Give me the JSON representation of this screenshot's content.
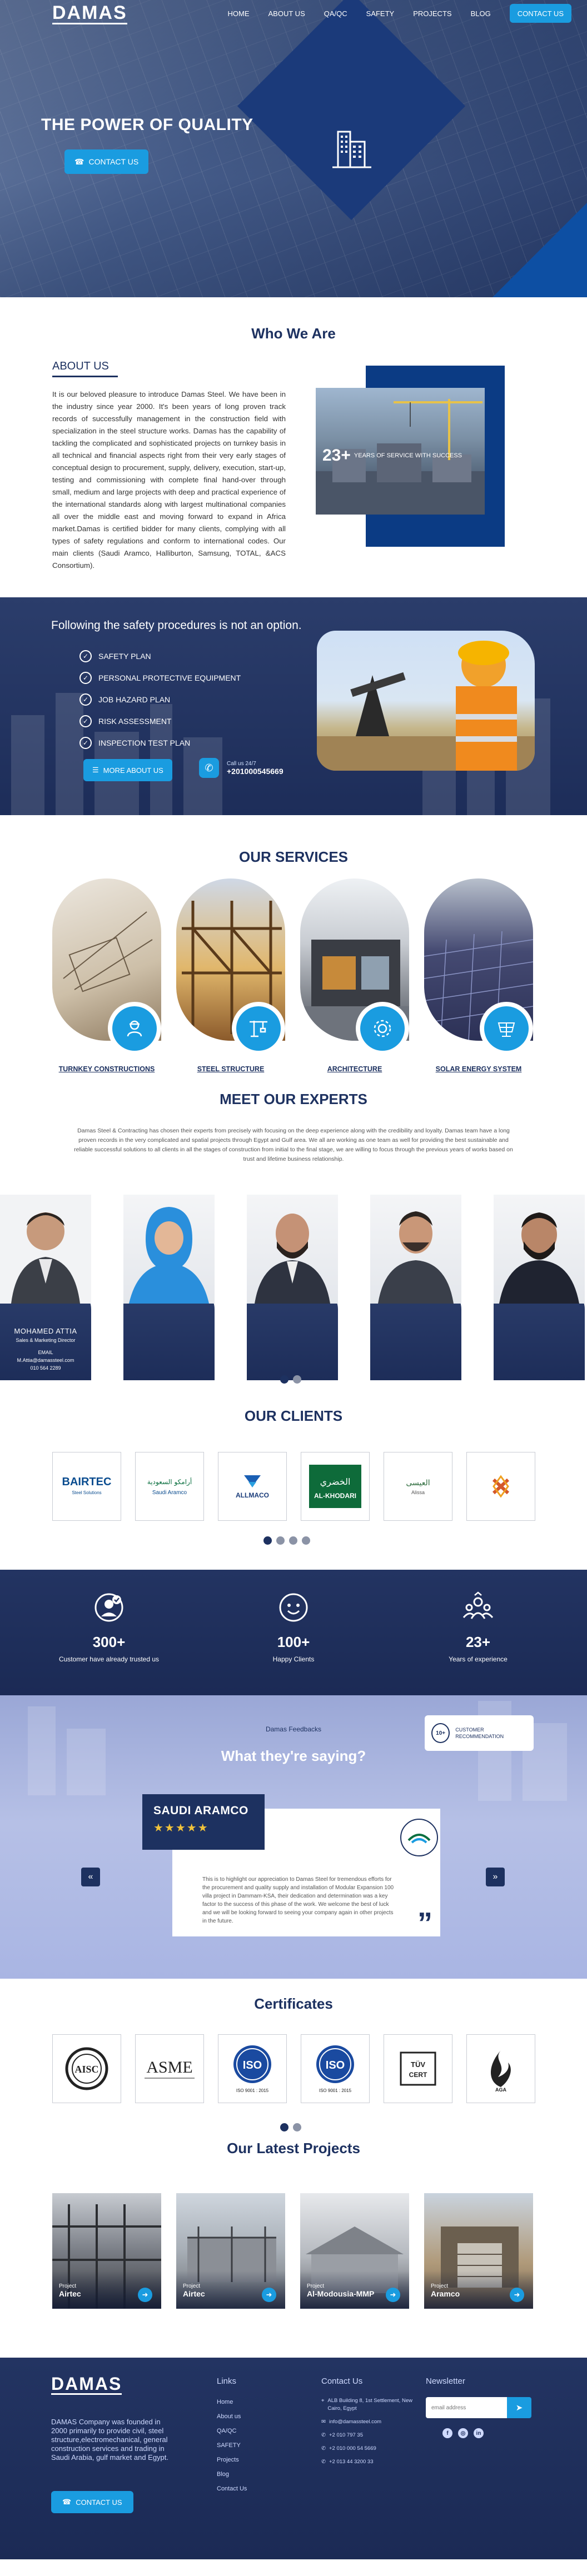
{
  "brand": {
    "logo": "DAMAS"
  },
  "nav": {
    "items": [
      "HOME",
      "ABOUT US",
      "QA/QC",
      "SAFETY",
      "PROJECTS",
      "BLOG"
    ],
    "contact_label": "CONTACT US"
  },
  "hero": {
    "title": "THE POWER OF QUALITY",
    "cta": "CONTACT US"
  },
  "who": {
    "title": "Who We Are",
    "label": "ABOUT US",
    "text": "It is our beloved pleasure to introduce Damas Steel. We have been in the industry since year 2000. It's been years of long proven track records of successfully management in the construction field with specialization in the steel structure works. Damas has the capability of tackling the complicated and sophisticated projects on turnkey basis in all technical and financial aspects right from their very early stages of conceptual design to procurement, supply, delivery, execution, start-up, testing and commissioning with complete final hand-over through small, medium and large projects with deep and practical experience of the international standards along with largest multinational companies all over the middle east and moving forward to expand in Africa market.Damas is certified bidder for many clients, complying with all types of safety regulations and conform to international codes. Our main clients (Saudi Aramco, Halliburton, Samsung, TOTAL, &ACS Consortium).",
    "badge_num": "23+",
    "badge_text": "YEARS OF SERVICE WITH SUCCESS"
  },
  "safety": {
    "title": "Following the safety procedures is not an option.",
    "items": [
      "SAFETY PLAN",
      "PERSONAL PROTECTIVE EQUIPMENT",
      "JOB HAZARD PLAN",
      "RISK ASSESSMENT",
      "INSPECTION TEST PLAN"
    ],
    "more": "MORE ABOUT US",
    "call_label": "Call us 24/7",
    "call_number": "+201000545669"
  },
  "services": {
    "title": "OUR SERVICES",
    "items": [
      {
        "label": "TURNKEY CONSTRUCTIONS",
        "icon": "engineer-icon"
      },
      {
        "label": "STEEL STRUCTURE",
        "icon": "crane-icon"
      },
      {
        "label": "ARCHITECTURE",
        "icon": "gear-icon"
      },
      {
        "label": "SOLAR ENERGY SYSTEM",
        "icon": "solar-panel-icon"
      }
    ]
  },
  "experts": {
    "title": "MEET OUR EXPERTS",
    "intro": "Damas Steel & Contracting has chosen their experts from precisely with focusing on the deep experience along with the credibility and loyalty. Damas team have a long proven records in the very complicated and spatial projects through Egypt and Gulf area. We all are working as one team as well for providing the best sustainable and reliable successful solutions to all clients in all the stages of construction from initial to the final stage, we are willing to focus through the previous years of works based on trust and lifetime business relationship.",
    "featured": {
      "name": "MOHAMED ATTIA",
      "role": "Sales & Marketing Director",
      "email_label": "EMAIL",
      "email": "M.Attia@damassteel.com",
      "phone": "010 564 2289"
    }
  },
  "clients": {
    "title": "OUR CLIENTS",
    "logos": [
      "BAIRTEC Steel Solutions",
      "Saudi Aramco",
      "ALLMACO",
      "AL-KHODARI",
      "Alissa",
      "Kuwait Petroleum"
    ]
  },
  "stats": [
    {
      "num": "300+",
      "label": "Customer have already trusted us",
      "icon": "medal-icon"
    },
    {
      "num": "100+",
      "label": "Happy Clients",
      "icon": "smile-icon"
    },
    {
      "num": "23+",
      "label": "Years of experience",
      "icon": "team-icon"
    }
  ],
  "testimonials": {
    "eyebrow": "Damas Feedbacks",
    "title": "What they're saying?",
    "badge_num": "10+",
    "badge_text": "CUSTOMER RECOMMENDATION",
    "company": "SAUDI ARAMCO",
    "stars": "★★★★★",
    "text": "This is to highlight our appreciation to Damas Steel for tremendous efforts for the procurement and quality supply and installation of Modular Expansion 100 villa project in Dammam-KSA, their dedication and determination was a key factor to the success of this phase of the work. We welcome the best of luck and we will be looking forward to seeing your company again in other projects in the future."
  },
  "certificates": {
    "title": "Certificates",
    "items": [
      "AISC",
      "ASME",
      "ISO 9001 : 2015",
      "ISO 9001 : 2015",
      "TUV CERT",
      "AGA"
    ]
  },
  "projects": {
    "title": "Our Latest Projects",
    "label": "Project",
    "items": [
      "Airtec",
      "Airtec",
      "Al-Modousia-MMP",
      "Aramco"
    ]
  },
  "footer": {
    "logo": "DAMAS",
    "desc": "DAMAS Company was founded in 2000 primarily to provide civil, steel structure,electromechanical, general construction services and trading in Saudi Arabia, gulf market and Egypt.",
    "cta": "CONTACT US",
    "links_title": "Links",
    "links": [
      "Home",
      "About us",
      "QA/QC",
      "SAFETY",
      "Projects",
      "Blog",
      "Contact Us"
    ],
    "contact_title": "Contact Us",
    "address": "ALB Building 8, 1st Settlement, New Cairo, Egypt",
    "email": "info@damassteel.com",
    "phone1": "+2 010 797 35",
    "phone2": "+2 010 000 54 5669",
    "phone3": "+2 013 44 3200 33",
    "news_title": "Newsletter",
    "email_placeholder": "email address",
    "socials": [
      "facebook-icon",
      "instagram-icon",
      "linkedin-icon"
    ]
  },
  "colors": {
    "navy": "#1d3160",
    "accent": "#1a9ce0",
    "dark": "#1d2d59"
  }
}
